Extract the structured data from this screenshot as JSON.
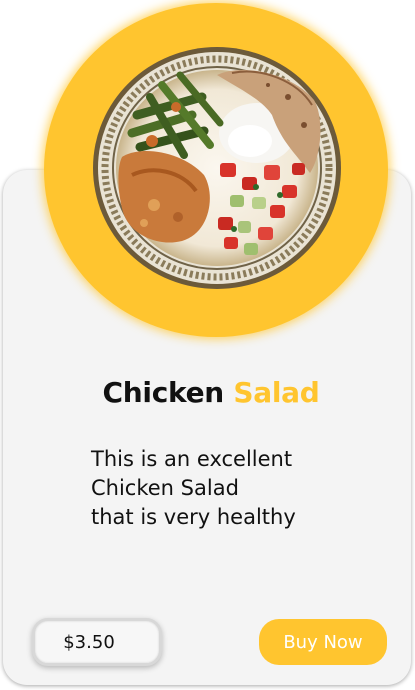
{
  "product": {
    "title_main": "Chicken",
    "title_accent": "Salad",
    "description_lines": [
      "This is an excellent",
      "Chicken Salad",
      "that is very healthy"
    ],
    "price": "$3.50",
    "buy_label": "Buy Now",
    "image_icon": "food-plate-image"
  },
  "colors": {
    "accent": "#ffc52f",
    "card_background": "#f4f4f4",
    "text": "#111111",
    "button_text": "#ffffff"
  }
}
